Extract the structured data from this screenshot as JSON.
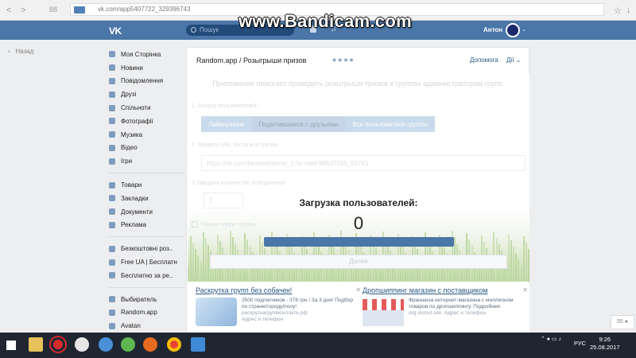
{
  "browser": {
    "url": "vk.com/app5407722_329396743",
    "tab_count": "88"
  },
  "watermark": "www.Bandicam.com",
  "header": {
    "logo": "VK",
    "search_placeholder": "Пошук",
    "user_name": "Антон"
  },
  "back_label": "Назад",
  "sidebar": {
    "items": [
      {
        "label": "Моя Сторінка",
        "icon": "home-icon"
      },
      {
        "label": "Новини",
        "icon": "news-icon"
      },
      {
        "label": "Повідомлення",
        "icon": "message-icon"
      },
      {
        "label": "Друзі",
        "icon": "user-icon"
      },
      {
        "label": "Спільноти",
        "icon": "group-icon"
      },
      {
        "label": "Фотографії",
        "icon": "camera-icon"
      },
      {
        "label": "Музика",
        "icon": "music-icon"
      },
      {
        "label": "Відео",
        "icon": "video-icon"
      },
      {
        "label": "Ігри",
        "icon": "game-icon"
      }
    ],
    "items2": [
      {
        "label": "Товари",
        "icon": "goods-icon"
      },
      {
        "label": "Закладки",
        "icon": "bookmark-icon"
      },
      {
        "label": "Документи",
        "icon": "document-icon"
      },
      {
        "label": "Реклама",
        "icon": "ads-icon"
      }
    ],
    "items3": [
      {
        "label": "Безкоштовні роз..",
        "icon": "app-icon"
      },
      {
        "label": "Free UA | Бесплатн",
        "icon": "app-icon"
      },
      {
        "label": "Бесплатно за ре..",
        "icon": "app-icon"
      }
    ],
    "items4": [
      {
        "label": "Выбиратель",
        "icon": "app-icon"
      },
      {
        "label": "Random.app",
        "icon": "app-icon"
      },
      {
        "label": "Avatan",
        "icon": "app-icon"
      }
    ]
  },
  "app": {
    "title": "Random.app / Розыгрыши призов",
    "rating": "★★★★",
    "help_label": "Допомога",
    "actions_label": "Дії",
    "description": "Приложение помогает проводить розыгрыши призов в группах администраторам групп.",
    "step1_label": "1. Фильтр пользователей:",
    "filters": [
      "Лайкнувшие",
      "Поделившиеся с друзьями",
      "Все пользователи группы"
    ],
    "step2_label": "2. Введите URL поста или группы",
    "url_value": "https://vk.com/bezkoshtovno_1?w=wall-98537395_55761",
    "step3_label": "3. Введите количество победителей",
    "winners_value": "1",
    "only_members_label": "Только члены группы",
    "next_label": "Далее",
    "loading_title": "Загрузка пользователей:",
    "loading_count": "0",
    "progress": 1.0
  },
  "ads": [
    {
      "title": "Раскрутка групп без собачек!",
      "text": "2500 подписчиков - 378 грн.! За 3 дня! Подбор по стране/городу/полу!",
      "sub": "раскруткагрупвконтакте.рф",
      "sub2": "Адрес и телефон"
    },
    {
      "title": "Дропшиппинг магазин с поставщиком",
      "text": "Франшиза интернет-магазина с миллионом товаров по дропшиппингу. Подробнее:",
      "sub": "org.domut.site",
      "sub2": "Адрес и телефон"
    }
  ],
  "notify_badge": "55",
  "taskbar": {
    "lang": "РУС",
    "time": "9:26",
    "date": "25.08.2017"
  }
}
